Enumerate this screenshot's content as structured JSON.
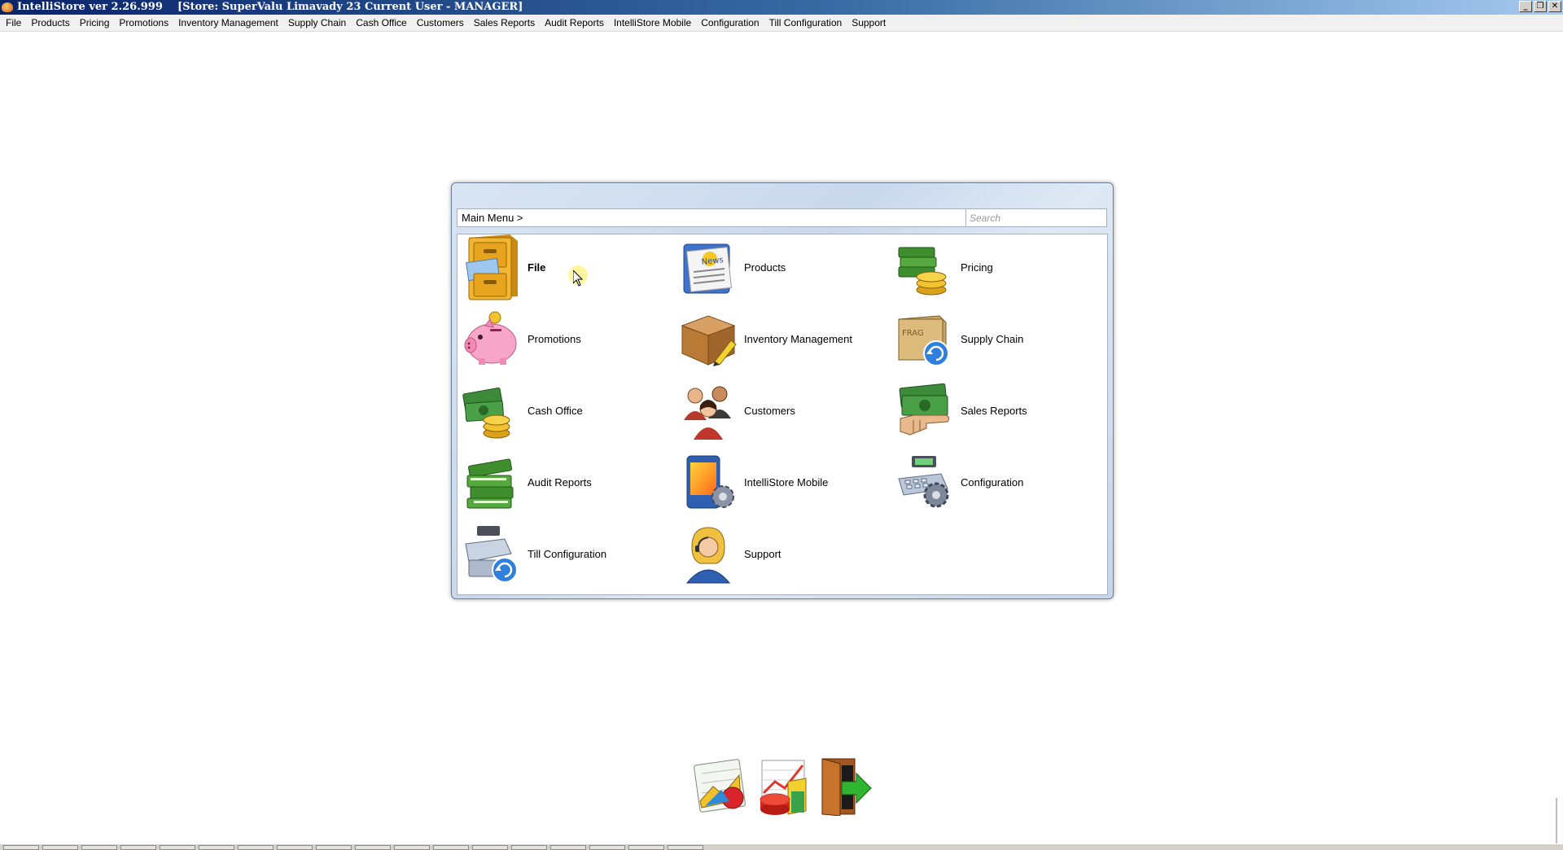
{
  "window": {
    "title": "IntelliStore ver 2.26.999",
    "subtitle": "[Store: SuperValu Limavady 23 Current User - MANAGER]",
    "buttons": [
      "_",
      "❐",
      "✕"
    ]
  },
  "menubar": {
    "items": [
      "File",
      "Products",
      "Pricing",
      "Promotions",
      "Inventory Management",
      "Supply Chain",
      "Cash Office",
      "Customers",
      "Sales Reports",
      "Audit Reports",
      "IntelliStore Mobile",
      "Configuration",
      "Till Configuration",
      "Support"
    ]
  },
  "main_menu": {
    "breadcrumb": "Main Menu >",
    "search_placeholder": "Search",
    "tiles": [
      {
        "label": "File",
        "icon": "filing-cabinet-icon"
      },
      {
        "label": "Products",
        "icon": "newspaper-icon"
      },
      {
        "label": "Pricing",
        "icon": "books-coins-icon"
      },
      {
        "label": "Promotions",
        "icon": "piggy-bank-icon"
      },
      {
        "label": "Inventory Management",
        "icon": "box-pencil-icon"
      },
      {
        "label": "Supply Chain",
        "icon": "fragile-box-refresh-icon"
      },
      {
        "label": "Cash Office",
        "icon": "cash-coins-icon"
      },
      {
        "label": "Customers",
        "icon": "people-icon"
      },
      {
        "label": "Sales Reports",
        "icon": "cash-hand-icon"
      },
      {
        "label": "Audit Reports",
        "icon": "green-books-icon"
      },
      {
        "label": "IntelliStore Mobile",
        "icon": "mobile-gear-icon"
      },
      {
        "label": "Configuration",
        "icon": "register-gear-icon"
      },
      {
        "label": "Till Configuration",
        "icon": "till-refresh-icon"
      },
      {
        "label": "Support",
        "icon": "support-agent-icon"
      }
    ]
  },
  "bottom_icons": [
    "dashboard-chart-icon",
    "sales-graph-icon",
    "exit-door-icon"
  ]
}
